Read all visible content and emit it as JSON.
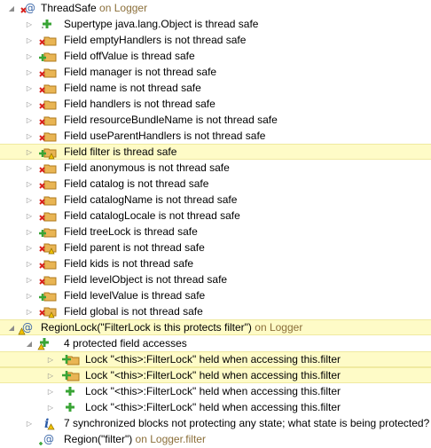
{
  "tree": {
    "root": {
      "label": "ThreadSafe",
      "suffix": " on Logger",
      "icon": "model-x-icon"
    },
    "children": [
      {
        "text": "Supertype java.lang.Object is thread safe",
        "icon": "green-plus-icon"
      },
      {
        "text": "Field emptyHandlers is not thread safe",
        "icon": "red-x-folder-icon"
      },
      {
        "text": "Field offValue is thread safe",
        "icon": "green-plus-folder-icon"
      },
      {
        "text": "Field manager is not thread safe",
        "icon": "red-x-folder-icon"
      },
      {
        "text": "Field name is not thread safe",
        "icon": "red-x-folder-icon"
      },
      {
        "text": "Field handlers is not thread safe",
        "icon": "red-x-folder-icon"
      },
      {
        "text": "Field resourceBundleName is not thread safe",
        "icon": "red-x-folder-icon"
      },
      {
        "text": "Field useParentHandlers is not thread safe",
        "icon": "red-x-folder-icon"
      },
      {
        "text": "Field filter is thread safe",
        "icon": "green-plus-folder-warning-icon",
        "highlight": true
      },
      {
        "text": "Field anonymous is not thread safe",
        "icon": "red-x-folder-icon"
      },
      {
        "text": "Field catalog is not thread safe",
        "icon": "red-x-folder-icon"
      },
      {
        "text": "Field catalogName is not thread safe",
        "icon": "red-x-folder-icon"
      },
      {
        "text": "Field catalogLocale is not thread safe",
        "icon": "red-x-folder-icon"
      },
      {
        "text": "Field treeLock is thread safe",
        "icon": "green-plus-folder-icon"
      },
      {
        "text": "Field parent is not thread safe",
        "icon": "red-x-folder-warning-icon"
      },
      {
        "text": "Field kids is not thread safe",
        "icon": "red-x-folder-icon"
      },
      {
        "text": "Field levelObject is not thread safe",
        "icon": "red-x-folder-icon"
      },
      {
        "text": "Field levelValue is thread safe",
        "icon": "green-plus-folder-icon"
      },
      {
        "text": "Field global is not thread safe",
        "icon": "red-x-folder-warning-icon"
      }
    ],
    "region": {
      "label": "RegionLock(\"FilterLock is this protects filter\")",
      "suffix": " on Logger",
      "icon": "model-warning-icon",
      "accesses": {
        "label": "4 protected field accesses",
        "icon": "green-plus-warning-icon",
        "items": [
          {
            "text": "Lock \"<this>:FilterLock\" held when accessing this.filter",
            "icon": "green-plus-folder-icon",
            "highlight": true
          },
          {
            "text": "Lock \"<this>:FilterLock\" held when accessing this.filter",
            "icon": "green-plus-folder-icon",
            "highlight": true
          },
          {
            "text": "Lock \"<this>:FilterLock\" held when accessing this.filter",
            "icon": "green-plus-icon"
          },
          {
            "text": "Lock \"<this>:FilterLock\" held when accessing this.filter",
            "icon": "green-plus-icon"
          }
        ]
      },
      "info": {
        "text": "7 synchronized blocks not protecting any state; what state is being protected?",
        "icon": "info-icon"
      },
      "regionFilter": {
        "label": "Region(\"filter\")",
        "suffix": " on Logger.filter",
        "icon": "model-at-icon"
      }
    }
  }
}
